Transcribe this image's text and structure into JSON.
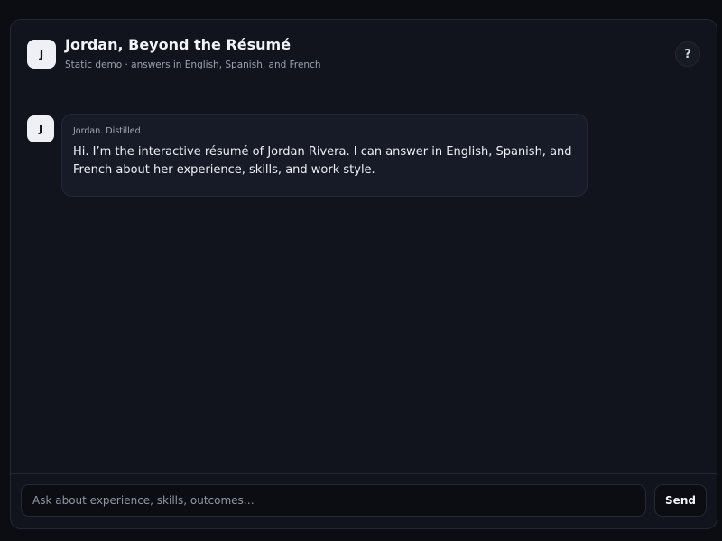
{
  "header": {
    "avatar_initial": "J",
    "title": "Jordan, Beyond the Résumé",
    "subtitle": "Static demo · answers in English, Spanish, and French",
    "help_label": "?"
  },
  "messages": [
    {
      "avatar_initial": "J",
      "sender": "Jordan. Distilled",
      "text": "Hi. I’m the interactive résumé of Jordan Rivera. I can answer in English, Spanish, and French about her experience, skills, and work style."
    }
  ],
  "composer": {
    "placeholder": "Ask about experience, skills, outcomes…",
    "value": "",
    "send_label": "Send"
  },
  "colors": {
    "page_background": "#0b0d13",
    "panel_background": "#11141c",
    "bubble_background": "#161b27",
    "avatar_background": "#eef0f6",
    "border": "#232834"
  }
}
